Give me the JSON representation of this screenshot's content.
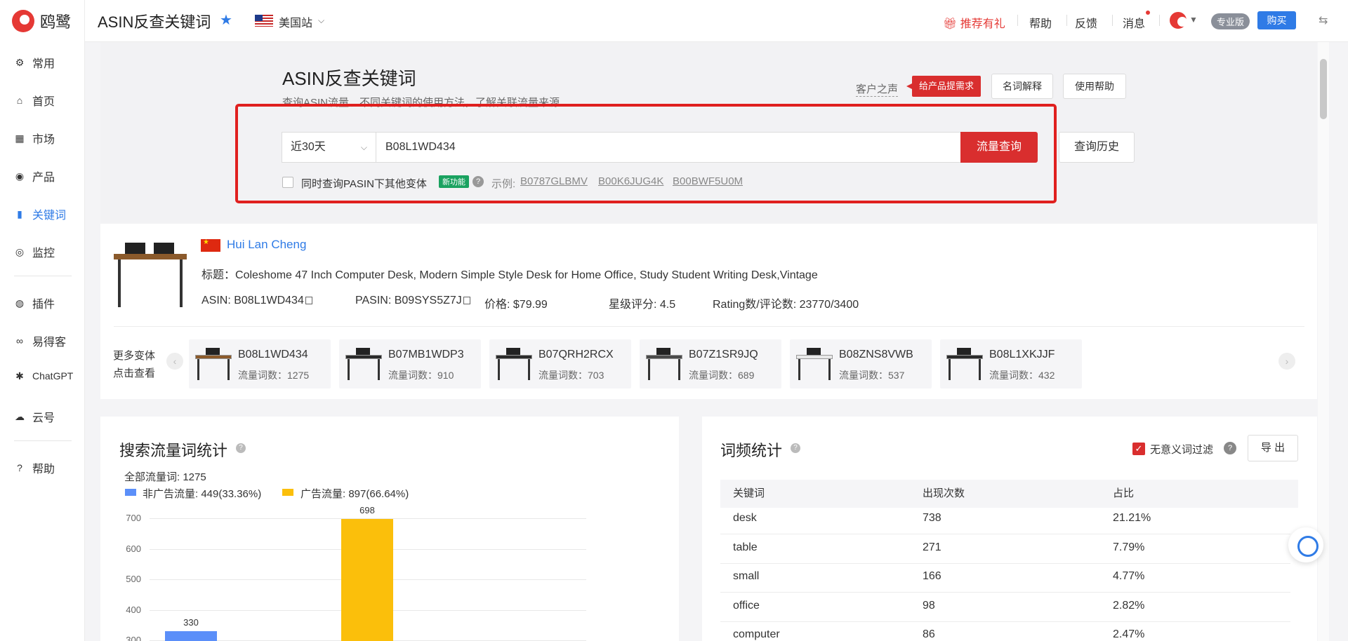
{
  "brand": {
    "logo_text": "鸥鹭"
  },
  "sidebar": {
    "items": [
      {
        "label": "常用",
        "icon": "gear-icon"
      },
      {
        "label": "首页",
        "icon": "home-icon"
      },
      {
        "label": "市场",
        "icon": "grid-icon"
      },
      {
        "label": "产品",
        "icon": "eye-icon"
      },
      {
        "label": "关键词",
        "icon": "bar-chart-icon"
      },
      {
        "label": "监控",
        "icon": "webcam-icon"
      },
      {
        "label": "插件",
        "icon": "chrome-icon"
      },
      {
        "label": "易得客",
        "icon": "link-icon"
      },
      {
        "label": "ChatGPT",
        "icon": "openai-icon"
      },
      {
        "label": "云号",
        "icon": "cloud-icon"
      },
      {
        "label": "帮助",
        "icon": "help-icon"
      }
    ],
    "active": "关键词"
  },
  "header": {
    "title": "ASIN反查关键词",
    "site": "美国站",
    "links": {
      "referral": "推荐有礼",
      "help": "帮助",
      "feedback": "反馈",
      "messages": "消息"
    },
    "plan_badge": "专业版",
    "buy": "购买"
  },
  "search": {
    "title": "ASIN反查关键词",
    "subtitle": "查询ASIN流量、不同关键词的使用方法，了解关联流量来源",
    "voice": "客户之声",
    "request_tag": "给产品提需求",
    "glossary": "名词解释",
    "usage_help": "使用帮助",
    "period": "近30天",
    "asin_value": "B08L1WD434",
    "query_btn": "流量查询",
    "history_btn": "查询历史",
    "variant_checkbox_label": "同时查询PASIN下其他变体",
    "new_badge": "新功能",
    "example_prefix": "示例:",
    "examples": [
      "B0787GLBMV",
      "B00K6JUG4K",
      "B00BWF5U0M"
    ]
  },
  "product": {
    "seller": "Hui Lan Cheng",
    "title_label": "标题：",
    "title": "Coleshome 47 Inch Computer Desk, Modern Simple Style Desk for Home Office, Study Student Writing Desk,Vintage",
    "asin": "ASIN: B08L1WD434",
    "pasin": "PASIN: B09SYS5Z7J",
    "price": "价格: $79.99",
    "rating": "星级评分: 4.5",
    "reviews": "Rating数/评论数: 23770/3400"
  },
  "variants": {
    "more_label_1": "更多变体",
    "more_label_2": "点击查看",
    "items": [
      {
        "asin": "B08L1WD434",
        "count": "流量词数：1275",
        "top": "#8b5a2b"
      },
      {
        "asin": "B07MB1WDP3",
        "count": "流量词数：910",
        "top": "#2b2b2b"
      },
      {
        "asin": "B07QRH2RCX",
        "count": "流量词数：703",
        "top": "#2b2b2b"
      },
      {
        "asin": "B07Z1SR9JQ",
        "count": "流量词数：689",
        "top": "#4a4a4a"
      },
      {
        "asin": "B08ZNS8VWB",
        "count": "流量词数：537",
        "top": "#e8e8e8"
      },
      {
        "asin": "B08L1XKJJF",
        "count": "流量词数：432",
        "top": "#2b2b2b"
      }
    ]
  },
  "traffic_stats": {
    "title": "搜索流量词统计",
    "total": "全部流量词: 1275",
    "legend_non_ad": "非广告流量: 449(33.36%)",
    "legend_ad": "广告流量: 897(66.64%)",
    "colors": {
      "non_ad": "#5b8ff9",
      "ad": "#fbbf0b"
    }
  },
  "chart_data": {
    "type": "bar",
    "series": [
      {
        "name": "非广告流量",
        "values": [
          330
        ]
      },
      {
        "name": "广告流量",
        "values": [
          698
        ]
      }
    ],
    "ytick_labels": [
      "300",
      "400",
      "500",
      "600",
      "700"
    ],
    "ylim": [
      300,
      700
    ],
    "grid": true
  },
  "word_freq": {
    "title": "词频统计",
    "filter_label": "无意义词过滤",
    "export": "导 出",
    "columns": [
      "关键词",
      "出现次数",
      "占比"
    ],
    "rows": [
      [
        "desk",
        "738",
        "21.21%"
      ],
      [
        "table",
        "271",
        "7.79%"
      ],
      [
        "small",
        "166",
        "4.77%"
      ],
      [
        "office",
        "98",
        "2.82%"
      ],
      [
        "computer",
        "86",
        "2.47%"
      ]
    ]
  }
}
